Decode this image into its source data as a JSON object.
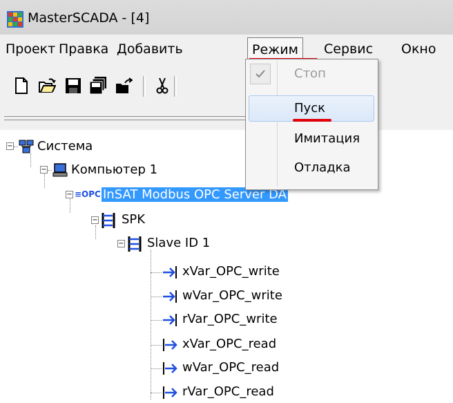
{
  "window": {
    "title": "MasterSCADA - [4]"
  },
  "menubar": {
    "items": [
      {
        "label": "Проект"
      },
      {
        "label": "Правка"
      },
      {
        "label": "Добавить"
      },
      {
        "label": "Режим",
        "active": true
      },
      {
        "label": "Сервис"
      },
      {
        "label": "Окно"
      }
    ]
  },
  "toolbar": {
    "buttons": [
      "new-file-icon",
      "open-folder-icon",
      "save-icon",
      "save-all-icon",
      "upload-icon",
      "cut-icon"
    ]
  },
  "mode_menu": {
    "items": [
      {
        "label": "Стоп",
        "enabled": false,
        "checked": true
      },
      {
        "label": "Пуск",
        "highlighted": true
      },
      {
        "label": "Имитация"
      },
      {
        "label": "Отладка"
      }
    ]
  },
  "tree": {
    "nodes": [
      {
        "label": "Система",
        "icon": "system-network-icon"
      },
      {
        "label": "Компьютер 1",
        "icon": "computer-icon"
      },
      {
        "label": "InSAT Modbus OPC Server DA",
        "icon": "opc-icon",
        "selected": true
      },
      {
        "label": "SPK",
        "icon": "device-group-icon"
      },
      {
        "label": "Slave ID 1",
        "icon": "device-group-icon"
      },
      {
        "label": "xVar_OPC_write",
        "icon": "write-variable-icon"
      },
      {
        "label": "wVar_OPC_write",
        "icon": "write-variable-icon"
      },
      {
        "label": "rVar_OPC_write",
        "icon": "write-variable-icon"
      },
      {
        "label": "xVar_OPC_read",
        "icon": "read-variable-icon"
      },
      {
        "label": "wVar_OPC_read",
        "icon": "read-variable-icon"
      },
      {
        "label": "rVar_OPC_read",
        "icon": "read-variable-icon"
      }
    ]
  },
  "colors": {
    "selection": "#3399ff",
    "annotation_red": "#e0000b",
    "variable_blue": "#1f4fe0"
  }
}
